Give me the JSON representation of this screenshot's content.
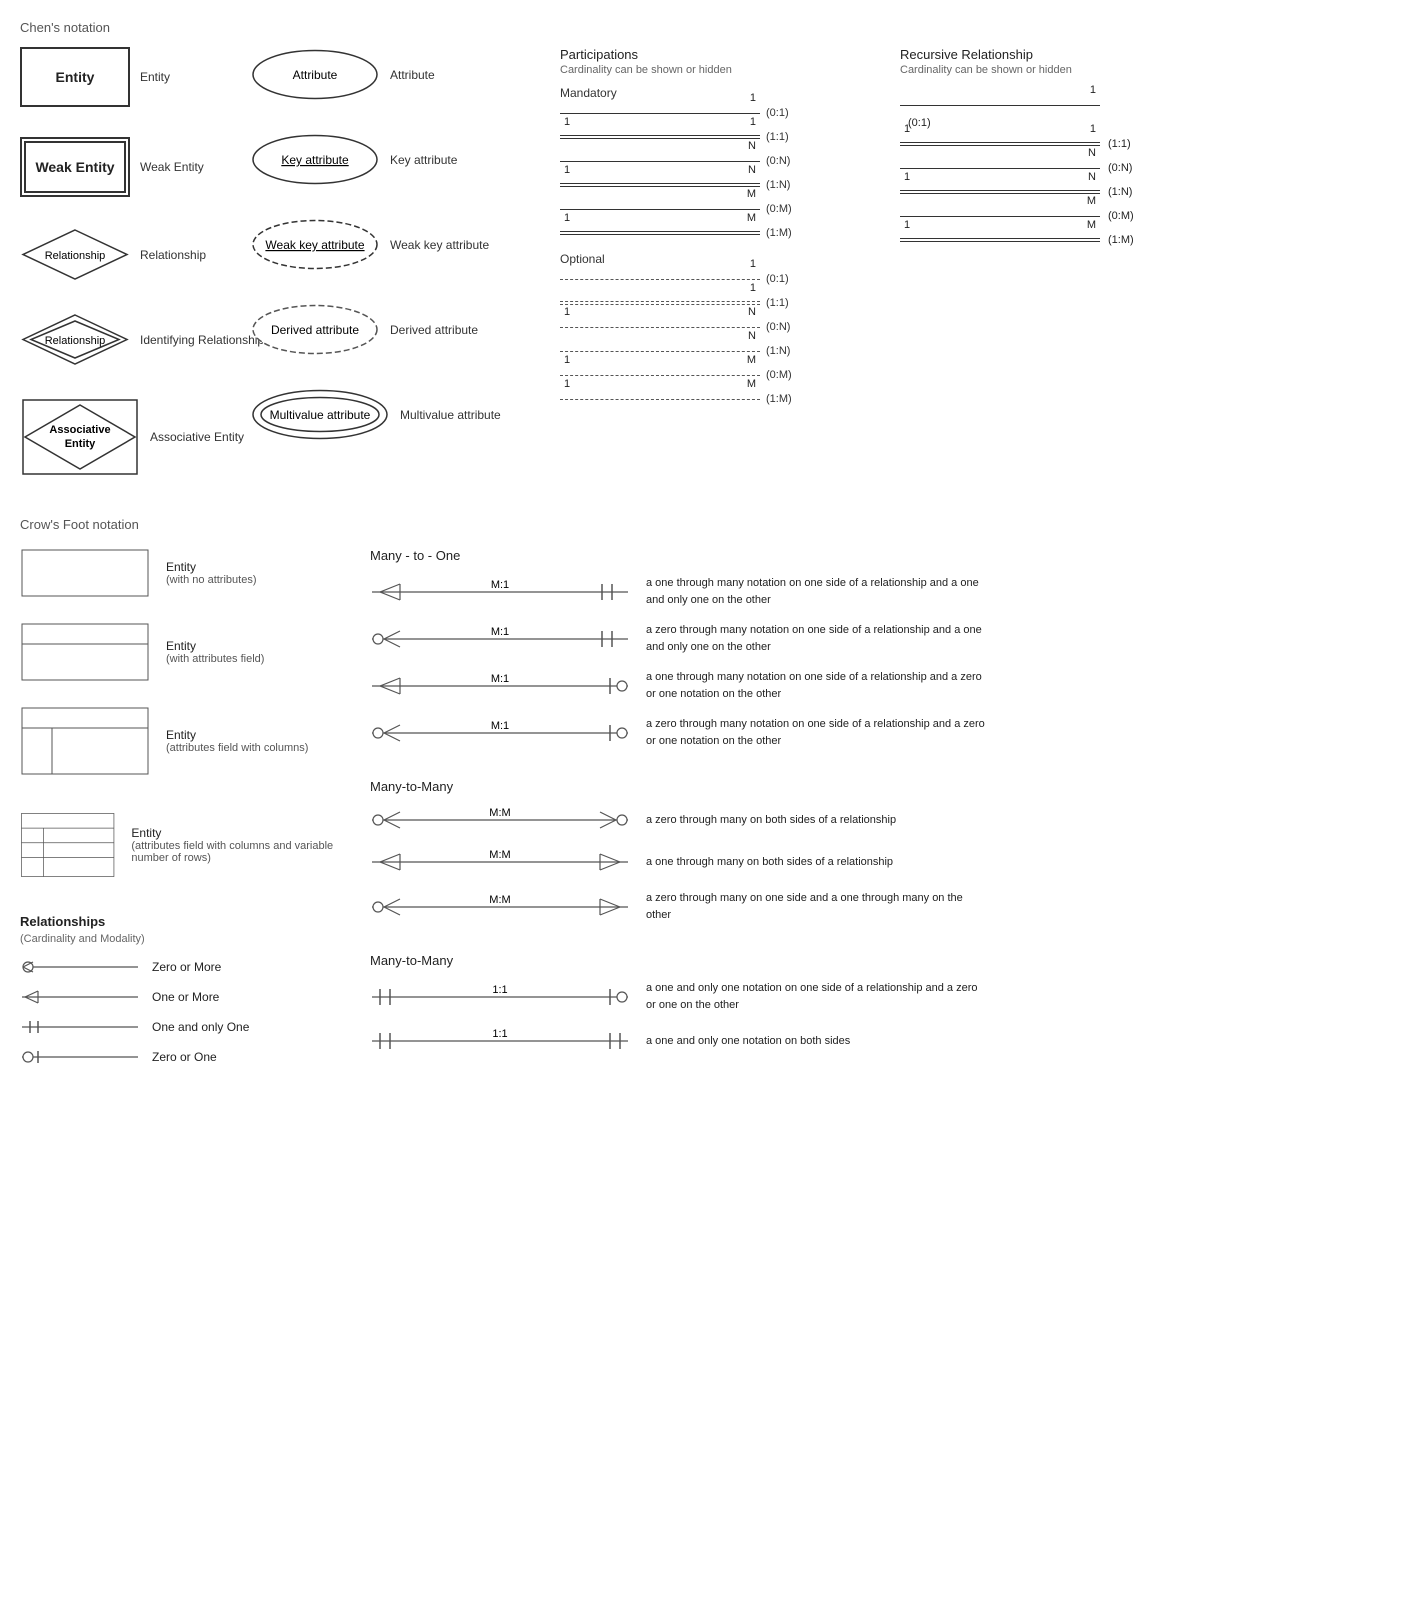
{
  "chens": {
    "title": "Chen's notation",
    "shapes": {
      "entity": "Entity",
      "weakEntity": "Weak Entity",
      "relationship": "Relationship",
      "identifyingRelationship": "Identifying Relationship",
      "associativeEntity": "Associative Entity"
    },
    "attributes": {
      "attribute": "Attribute",
      "keyAttribute": "Key attribute",
      "weakKeyAttribute": "Weak key attribute",
      "derivedAttribute": "Derived attribute",
      "multivalueAttribute": "Multivalue attribute"
    }
  },
  "participations": {
    "title": "Participations",
    "subtitle": "Cardinality can be shown or hidden",
    "mandatory": "Mandatory",
    "optional": "Optional",
    "mandatory_rows": [
      {
        "left": "1",
        "right": "1",
        "label": "(0:1)"
      },
      {
        "left": "1",
        "right": "1",
        "label": "(1:1)"
      },
      {
        "left": "",
        "right": "N",
        "label": "(0:N)"
      },
      {
        "left": "1",
        "right": "N",
        "label": "(1:N)"
      },
      {
        "left": "",
        "right": "M",
        "label": "(0:M)"
      },
      {
        "left": "1",
        "right": "M",
        "label": "(1:M)"
      }
    ],
    "optional_rows": [
      {
        "left": "",
        "right": "1",
        "label": "(0:1)"
      },
      {
        "left": "",
        "right": "1",
        "label": "(1:1)"
      },
      {
        "left": "1",
        "right": "N",
        "label": "(0:N)"
      },
      {
        "left": "",
        "right": "N",
        "label": "(1:N)"
      },
      {
        "left": "1",
        "right": "M",
        "label": "(0:M)"
      },
      {
        "left": "1",
        "right": "M",
        "label": "(1:M)"
      }
    ]
  },
  "recursive": {
    "title": "Recursive Relationship",
    "subtitle": "Cardinality can be shown or hidden",
    "rows": [
      {
        "left": "",
        "right": "1",
        "label": "(0:1)"
      },
      {
        "left": "1",
        "right": "1",
        "label": "(1:1)"
      },
      {
        "left": "",
        "right": "N",
        "label": "(0:N)"
      },
      {
        "left": "1",
        "right": "N",
        "label": "(1:N)"
      },
      {
        "left": "",
        "right": "M",
        "label": "(0:M)"
      },
      {
        "left": "1",
        "right": "M",
        "label": "(1:M)"
      }
    ]
  },
  "crows": {
    "title": "Crow's Foot notation",
    "entities": [
      {
        "label": "Entity",
        "sublabel": "(with no attributes)"
      },
      {
        "label": "Entity",
        "sublabel": "(with attributes field)"
      },
      {
        "label": "Entity",
        "sublabel": "(attributes field with columns)"
      },
      {
        "label": "Entity",
        "sublabel": "(attributes field with columns and variable number of rows)"
      }
    ],
    "relationships": {
      "title": "Relationships",
      "subtitle": "(Cardinality and Modality)",
      "items": [
        {
          "symbol": "zero-or-more",
          "label": "Zero or More"
        },
        {
          "symbol": "one-or-more",
          "label": "One or More"
        },
        {
          "symbol": "one-and-only",
          "label": "One and only One"
        },
        {
          "symbol": "zero-or-one",
          "label": "Zero or One"
        }
      ]
    },
    "many_to_one": {
      "title": "Many - to - One",
      "rows": [
        {
          "ratio": "M:1",
          "desc": "a one through many notation on one side of a relationship and a one and only one on the other"
        },
        {
          "ratio": "M:1",
          "desc": "a zero through many notation on one side of a relationship and a one and only one on the other"
        },
        {
          "ratio": "M:1",
          "desc": "a one through many notation on one side of a relationship and a zero or one notation on the other"
        },
        {
          "ratio": "M:1",
          "desc": "a zero through many notation on one side of a relationship and a zero or one notation on the other"
        }
      ]
    },
    "many_to_many": {
      "title": "Many-to-Many",
      "rows": [
        {
          "ratio": "M:M",
          "desc": "a zero through many on both sides of a relationship"
        },
        {
          "ratio": "M:M",
          "desc": "a one through many on both sides of a relationship"
        },
        {
          "ratio": "M:M",
          "desc": "a zero through many on one side and a one through many on the other"
        }
      ]
    },
    "one_to_one": {
      "title": "Many-to-Many",
      "rows": [
        {
          "ratio": "1:1",
          "desc": "a one and only one notation on one side of a relationship and a zero or one on the other"
        },
        {
          "ratio": "1:1",
          "desc": "a one and only one notation on both sides"
        }
      ]
    }
  }
}
